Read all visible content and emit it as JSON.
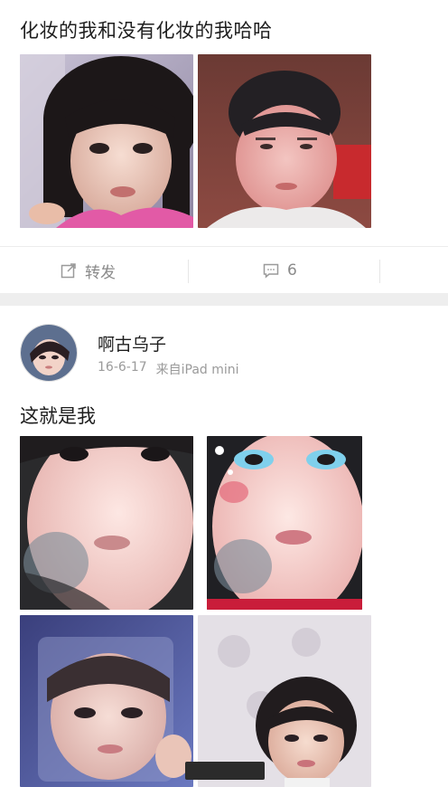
{
  "post1": {
    "text": "化妆的我和没有化妆的我哈哈",
    "photos": [
      "photo-with-makeup",
      "photo-without-makeup"
    ],
    "actions": {
      "repost_label": "转发",
      "comment_count": "6"
    }
  },
  "post2": {
    "author": "啊古乌子",
    "date": "16-6-17",
    "source": "来自iPad mini",
    "text": "这就是我",
    "photos": [
      "selfie-1",
      "selfie-2",
      "selfie-3",
      "selfie-4"
    ]
  },
  "icons": {
    "repost": "repost-icon",
    "comment": "comment-icon"
  },
  "colors": {
    "text": "#1e1e1e",
    "meta": "#9a9a9a",
    "action": "#8a8a8a",
    "separator": "#eeeeee"
  }
}
